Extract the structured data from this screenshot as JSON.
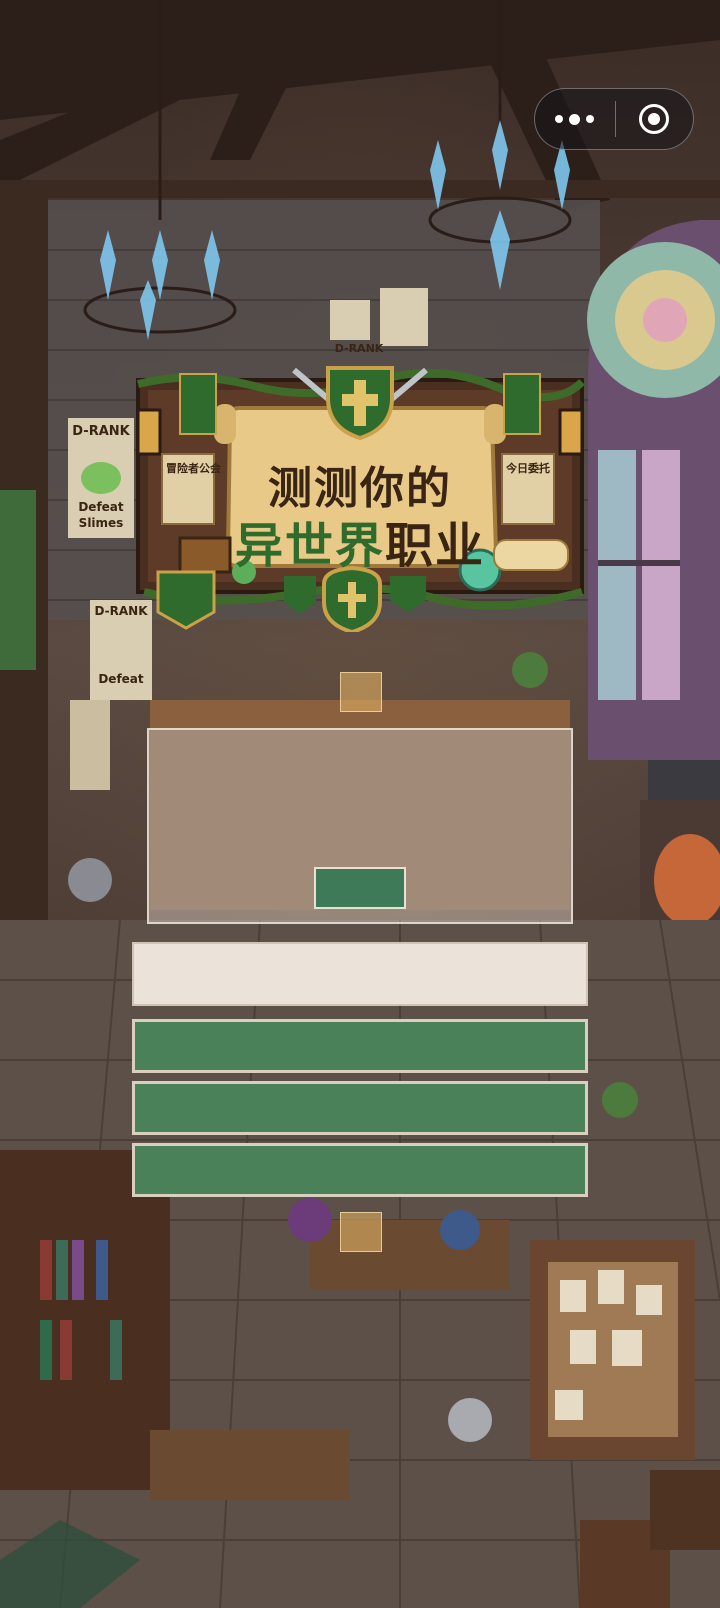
{
  "title": {
    "line1": "测测你的",
    "line2_part1": "异世界",
    "line2_part2": "职业"
  },
  "banner_notes": {
    "left_board": "冒险者公会",
    "right_board": "今日委托",
    "left_poster_top": "D-RANK",
    "left_poster_text1": "Defeat",
    "left_poster_text2": "Slimes",
    "second_poster_top": "D-RANK",
    "second_poster_text": "Defeat",
    "upper_poster_top": "D-RANK"
  },
  "capsule": {
    "more_icon": "more-dots-icon",
    "close_icon": "target-circle-icon"
  },
  "quiz": {
    "panel_button_label": "",
    "input_value": "",
    "options": [
      "",
      "",
      ""
    ]
  },
  "colors": {
    "accent_green": "#4a8159",
    "panel_button": "#3f7a58",
    "input_bg": "#ebe3da",
    "title_brown": "#3a2413",
    "title_green": "#2f6b2c"
  }
}
